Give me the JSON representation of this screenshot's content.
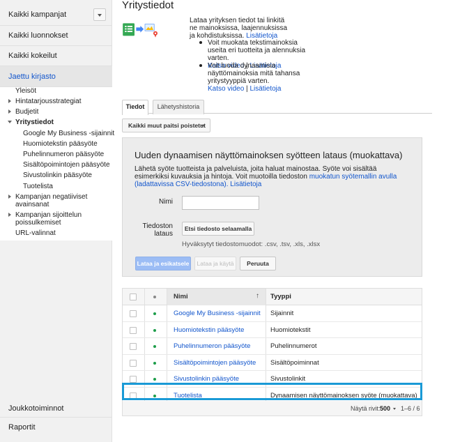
{
  "sidebar": {
    "campaigns": "Kaikki kampanjat",
    "drafts": "Kaikki luonnokset",
    "experiments": "Kaikki kokeilut",
    "shared_library": "Jaettu kirjasto",
    "tree": [
      {
        "label": "Yleisöt"
      },
      {
        "label": "Hintatarjousstrategiat"
      },
      {
        "label": "Budjetit"
      },
      {
        "label": "Yritystiedot"
      },
      {
        "label": "Google My Business -sijainnit"
      },
      {
        "label": "Huomiotekstin pääsyöte"
      },
      {
        "label": "Puhelinnumeron pääsyöte"
      },
      {
        "label": "Sisältöpoimintojen pääsyöte"
      },
      {
        "label": "Sivustolinkin pääsyöte"
      },
      {
        "label": "Tuotelista"
      },
      {
        "label": "Kampanjan negatiiviset avainsanat"
      },
      {
        "label": "Kampanjan sijoittelun poissulkemiset"
      },
      {
        "label": "URL-valinnat"
      }
    ],
    "bulk_ops": "Joukkotoiminnot",
    "reports": "Raportit"
  },
  "header": {
    "title": "Yritystiedot",
    "intro": "Lataa yrityksen tiedot tai linkitä ne mainoksissa, laajennuksissa ja kohdistuksissa.",
    "intro_link": "Lisätietoja",
    "bullet1": "Voit muokata tekstimainoksia useita eri tuotteita ja alennuksia varten.",
    "bullet1_video": "Katso video",
    "bullet1_sep": "|",
    "bullet1_link": "Lisätietoja",
    "bullet2": "Voit luoda dynaamisia näyttömainoksia mitä tahansa yritystyyppiä varten.",
    "bullet2_video": "Katso video",
    "bullet2_sep": "|",
    "bullet2_link": "Lisätietoja"
  },
  "tabs": [
    {
      "label": "Tiedot"
    },
    {
      "label": "Lähetyshistoria"
    }
  ],
  "filter": "Kaikki muut paitsi poistetut",
  "upload": {
    "title": "Uuden dynaamisen näyttömainoksen syötteen lataus (muokattava)",
    "desc": "Lähetä syöte tuotteista ja palveluista, joita haluat mainostaa. Syöte voi sisältää esimerkiksi kuvauksia ja hintoja. Voit muotoilla tiedoston",
    "desc_link": "muokatun syötemallin avulla (ladattavissa CSV-tiedostona).",
    "desc_link2": "Lisätietoja",
    "name_label": "Nimi",
    "name_value": "",
    "file_label": "Tiedoston lataus",
    "browse": "Etsi tiedosto selaamalla",
    "accepted": "Hyväksytyt tiedostomuodot: .csv, .tsv, .xls, .xlsx",
    "preview_btn": "Lataa ja esikatsele",
    "apply_btn": "Lataa ja käytä",
    "cancel_btn": "Peruuta"
  },
  "table": {
    "headers": {
      "name": "Nimi",
      "type": "Tyyppi"
    },
    "rows": [
      {
        "name": "Google My Business -sijainnit",
        "type": "Sijainnit"
      },
      {
        "name": "Huomiotekstin pääsyöte",
        "type": "Huomiotekstit"
      },
      {
        "name": "Puhelinnumeron pääsyöte",
        "type": "Puhelinnumerot"
      },
      {
        "name": "Sisältöpoimintojen pääsyöte",
        "type": "Sisältöpoiminnat"
      },
      {
        "name": "Sivustolinkin pääsyöte",
        "type": "Sivustolinkit"
      },
      {
        "name": "Tuotelista",
        "type": "Dynaamisen näyttömainoksen syöte (muokattava)"
      }
    ]
  },
  "pager": {
    "rows_label": "Näytä rivit:",
    "rows_value": "500",
    "range": "1–6 / 6"
  },
  "colors": {
    "link": "#1155cc",
    "highlight": "#1a9ad6",
    "status_green": "#1e9e4b"
  }
}
